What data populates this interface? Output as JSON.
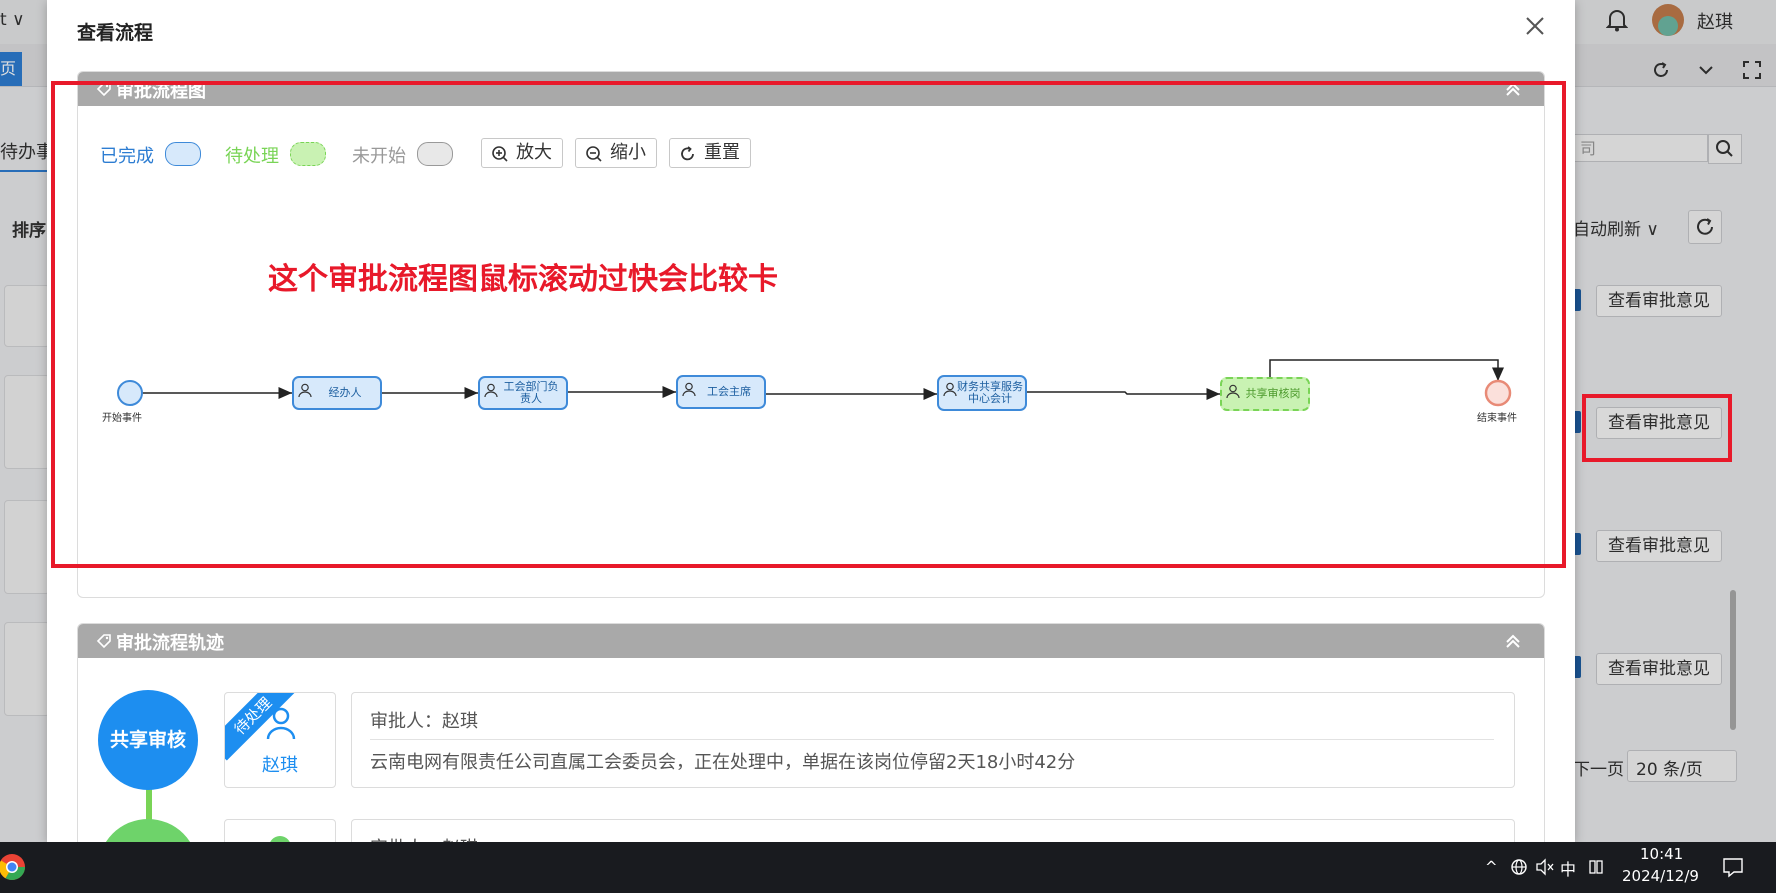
{
  "bg": {
    "user_name": "赵琪",
    "left_dropdown": "t",
    "left_tab": "页",
    "left_todo": "待办事",
    "left_sort": "排序",
    "search_placeholder": "司",
    "auto_refresh": "自动刷新",
    "opinion_button": "查看审批意见",
    "next_page": "下一页",
    "page_size": "20 条/页"
  },
  "modal": {
    "title": "查看流程",
    "diagram_section": "审批流程图",
    "track_section": "审批流程轨迹",
    "annotation": "这个审批流程图鼠标滚动过快会比较卡"
  },
  "legend": {
    "done": "已完成",
    "pending": "待处理",
    "not_started": "未开始",
    "colors": {
      "done_fill": "#d7e9fb",
      "done_border": "#3e8ad9",
      "pending_fill": "#c9f2b3",
      "pending_border": "#79d456",
      "not_started_fill": "#e8e8e8"
    }
  },
  "toolbar": {
    "zoom_in": "放大",
    "zoom_out": "缩小",
    "reset": "重置"
  },
  "flow": {
    "start": "开始事件",
    "end": "结束事件",
    "n1": "经办人",
    "n2": "工会部门负责人",
    "n3": "工会主席",
    "n4": "财务共享服务中心会计",
    "n5": "共享审核岗"
  },
  "track": {
    "step1_label": "共享审核",
    "ribbon": "待处理",
    "person1": "赵琪",
    "approver_label": "审批人：赵琪",
    "status_text": "云南电网有限责任公司直属工会委员会，正在处理中，单据在该岗位停留2天18小时42分",
    "approver_label2": "审批人：赵琪"
  },
  "taskbar": {
    "ime": "中",
    "time": "10:41",
    "date": "2024/12/9"
  }
}
